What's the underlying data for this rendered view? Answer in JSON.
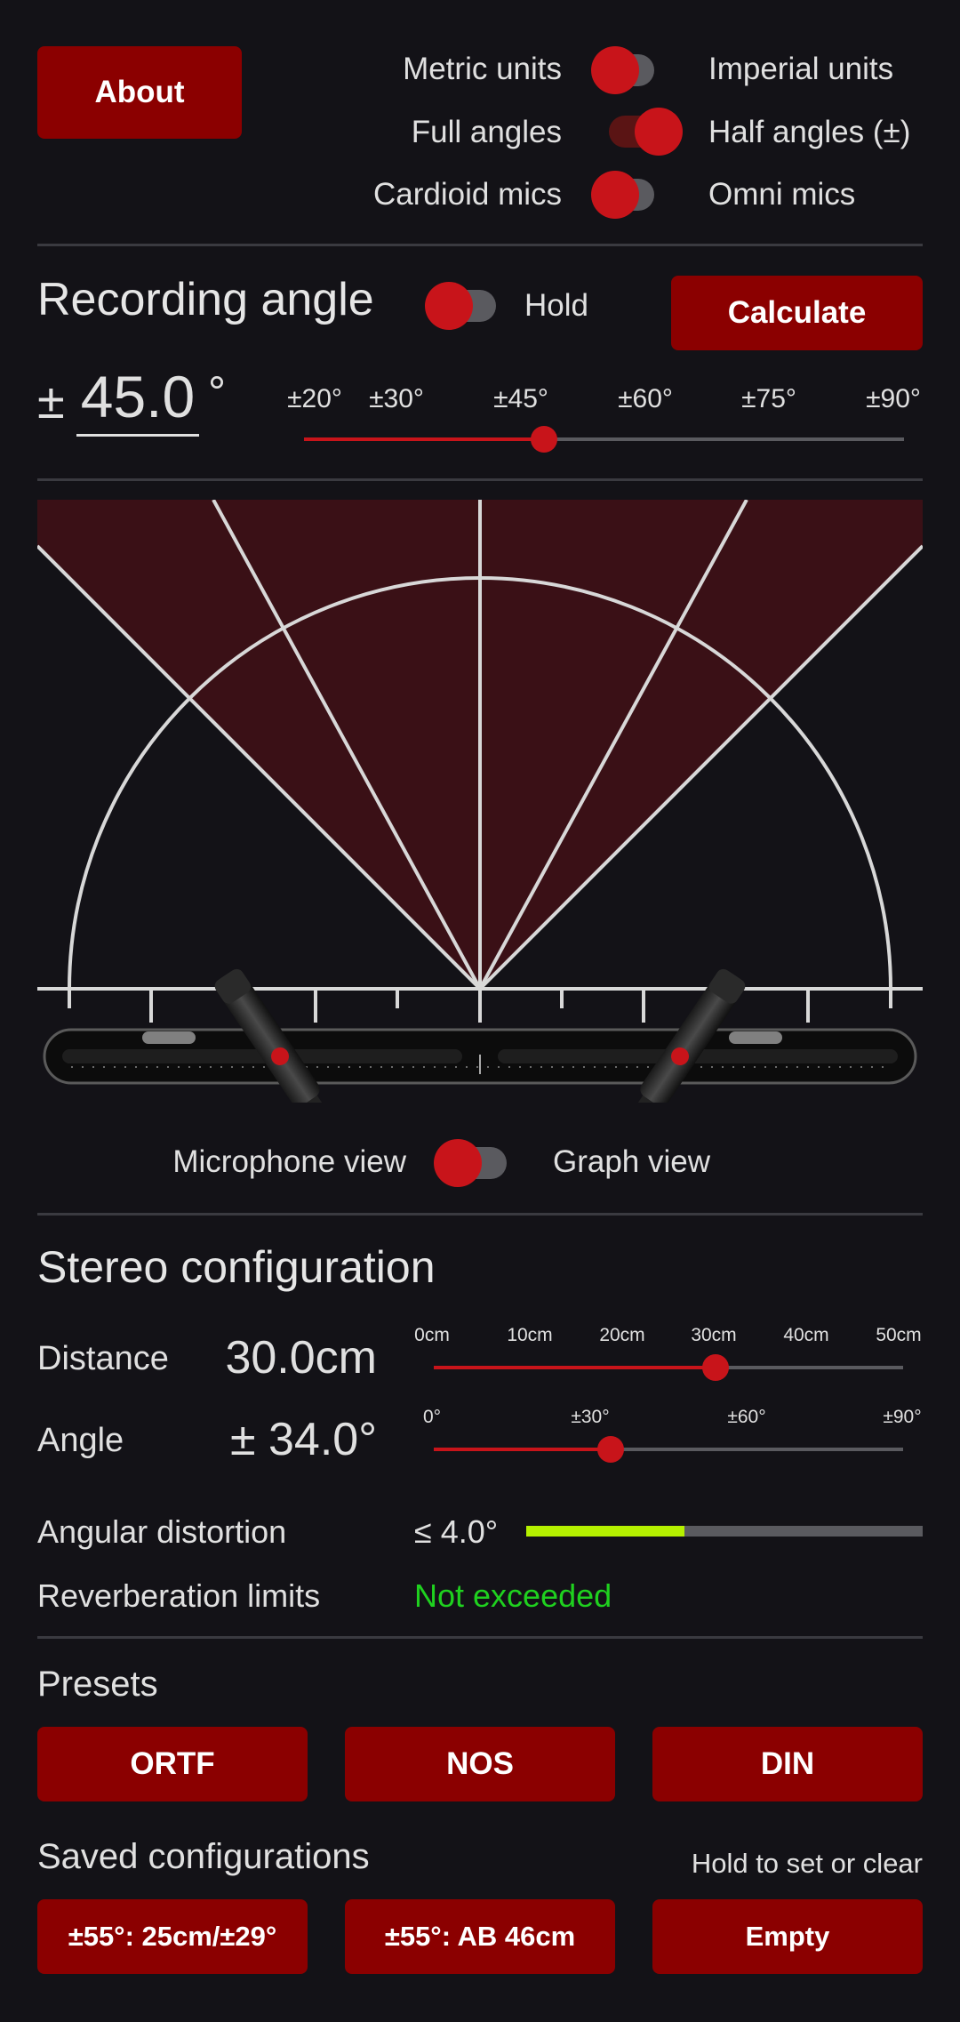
{
  "header": {
    "about_label": "About",
    "units": {
      "left": "Metric units",
      "right": "Imperial units",
      "state": "left"
    },
    "angles": {
      "left": "Full angles",
      "right": "Half angles (±)",
      "state": "right"
    },
    "mics": {
      "left": "Cardioid mics",
      "right": "Omni mics",
      "state": "left"
    }
  },
  "recording": {
    "title": "Recording angle",
    "hold_label": "Hold",
    "calculate_label": "Calculate",
    "prefix": "±",
    "value": "45.0",
    "unit": "°",
    "slider_ticks": [
      "±20°",
      "±30°",
      "±45°",
      "±60°",
      "±75°",
      "±90°"
    ],
    "slider_value_deg": 45,
    "slider_min_deg": 15,
    "slider_max_deg": 90
  },
  "view_toggle": {
    "left": "Microphone view",
    "right": "Graph view",
    "state": "left"
  },
  "stereo": {
    "title": "Stereo configuration",
    "distance_label": "Distance",
    "distance_value": "30.0cm",
    "distance_ticks": [
      "0cm",
      "10cm",
      "20cm",
      "30cm",
      "40cm",
      "50cm"
    ],
    "distance_cm": 30,
    "distance_max_cm": 50,
    "angle_label": "Angle",
    "angle_value": "± 34.0°",
    "angle_ticks": [
      "0°",
      "±30°",
      "±60°",
      "±90°"
    ],
    "angle_deg": 34,
    "angle_max_deg": 90,
    "distortion_label": "Angular distortion",
    "distortion_value": "≤ 4.0°",
    "distortion_fraction": 0.4,
    "distortion_color": "#b5f000",
    "reverb_label": "Reverberation limits",
    "reverb_value": "Not exceeded",
    "reverb_color": "#1fd11f"
  },
  "presets": {
    "title": "Presets",
    "buttons": [
      "ORTF",
      "NOS",
      "DIN"
    ]
  },
  "saved": {
    "title": "Saved configurations",
    "hint": "Hold to set or clear",
    "buttons": [
      "±55°: 25cm/±29°",
      "±55°: AB 46cm",
      "Empty"
    ]
  },
  "colors": {
    "accent": "#8b0000",
    "toggle_red": "#c8141a",
    "background": "#131217"
  }
}
